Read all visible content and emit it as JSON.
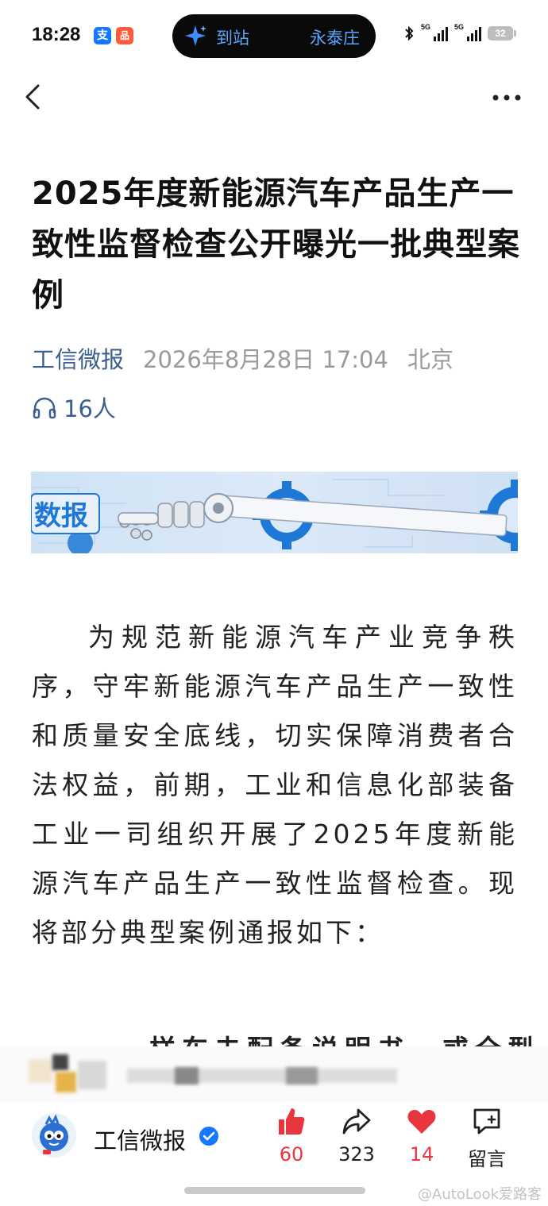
{
  "status_bar": {
    "time": "18:28",
    "app_icon_1": "支",
    "app_icon_2": "品",
    "pill": {
      "left_text": "到站",
      "right_text": "永泰庄"
    },
    "signal_1_label": "5G",
    "signal_2_label": "5G",
    "battery": "32"
  },
  "nav": {
    "back_icon": "chevron-left-icon",
    "more_icon": "ellipsis-icon"
  },
  "article": {
    "title": "2025年度新能源汽车产品生产一致性监督检查公开曝光一批典型案例",
    "author": "工信微报",
    "date": "2026年8月28日 17:04",
    "location": "北京",
    "listeners": "16人",
    "banner_text": "数报",
    "body": "为规范新能源汽车产业竞争秩序，守牢新能源汽车产品生产一致性和质量安全底线，切实保障消费者合法权益，前期，工业和信息化部装备工业一司组织开展了2025年度新能源汽车产品生产一致性监督检查。现将部分典型案例通报如下：",
    "subheading_partial": "样车未配备说明书，或全型"
  },
  "bottom_bar": {
    "account_name": "工信微报",
    "actions": [
      {
        "icon": "thumbs-up-icon",
        "count": "60",
        "color": "#e8353e"
      },
      {
        "icon": "share-icon",
        "count": "323",
        "color": "#222222"
      },
      {
        "icon": "heart-icon",
        "count": "14",
        "color": "#e8353e"
      },
      {
        "icon": "comment-icon",
        "count": "留言",
        "color": "#222222"
      }
    ]
  },
  "watermark": "@AutoLook爱路客"
}
